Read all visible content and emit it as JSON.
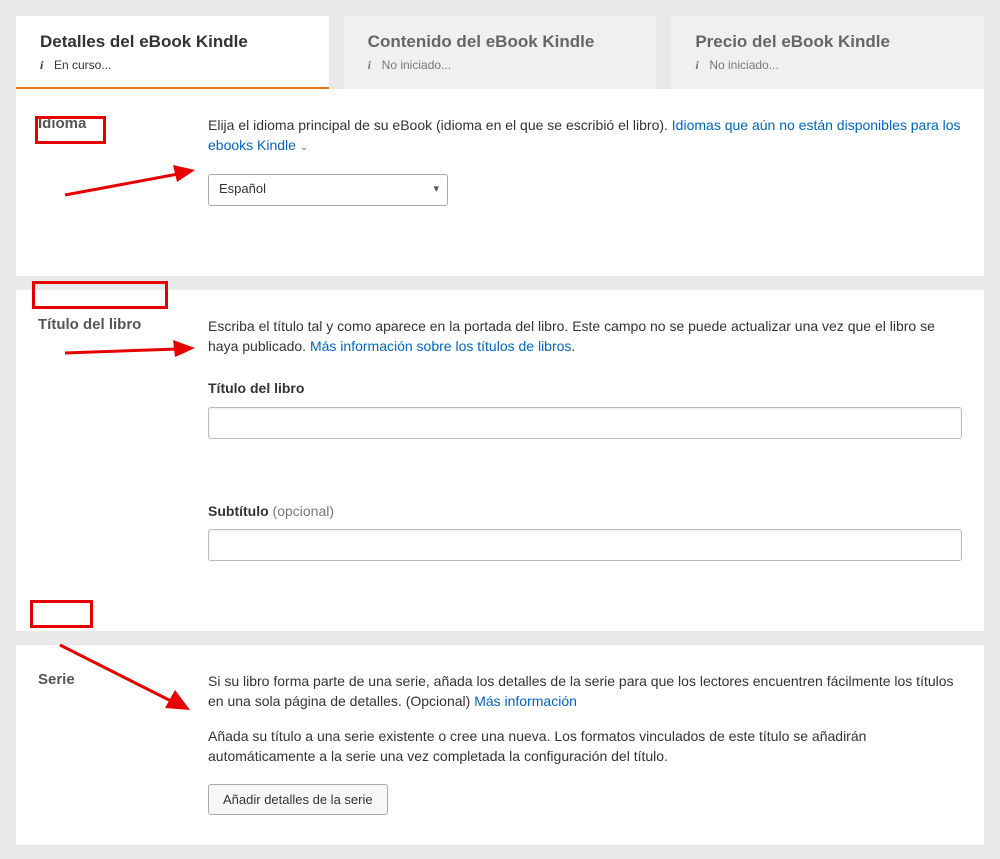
{
  "tabs": [
    {
      "title": "Detalles del eBook Kindle",
      "status": "En curso..."
    },
    {
      "title": "Contenido del eBook Kindle",
      "status": "No iniciado..."
    },
    {
      "title": "Precio del eBook Kindle",
      "status": "No iniciado..."
    }
  ],
  "idioma": {
    "heading": "Idioma",
    "desc": "Elija el idioma principal de su eBook (idioma en el que se escribió el libro). ",
    "link": "Idiomas que aún no están disponibles para los ebooks Kindle",
    "selected": "Español"
  },
  "titulo": {
    "heading": "Título del libro",
    "desc1": "Escriba el título tal y como aparece en la portada del libro. Este campo no se puede actualizar una vez que el libro se haya publicado. ",
    "link": "Más información sobre los títulos de libros",
    "field1_label": "Título del libro",
    "field2_label": "Subtítulo",
    "field2_opt": "(opcional)"
  },
  "serie": {
    "heading": "Serie",
    "desc1": "Si su libro forma parte de una serie, añada los detalles de la serie para que los lectores encuentren fácilmente los títulos en una sola página de detalles. (Opcional) ",
    "link": "Más información",
    "desc2": "Añada su título a una serie existente o cree una nueva. Los formatos vinculados de este título se añadirán automáticamente a la serie una vez completada la configuración del título.",
    "button": "Añadir detalles de la serie"
  }
}
